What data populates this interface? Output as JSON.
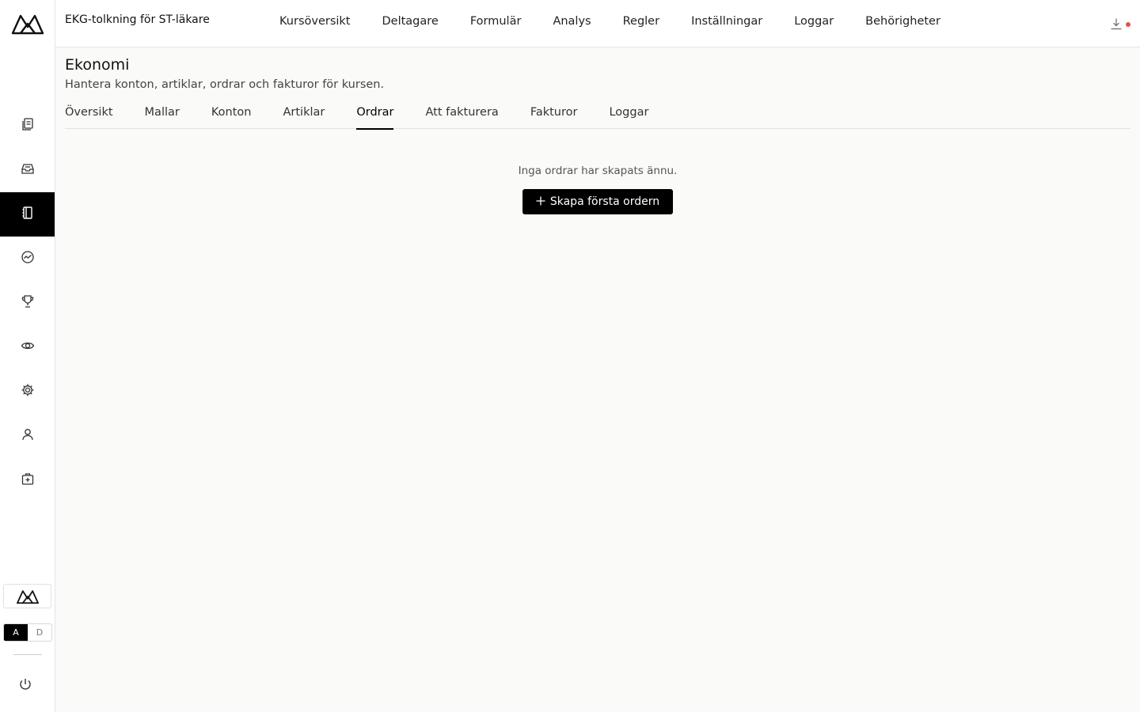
{
  "app": {
    "logo": "logo-icon"
  },
  "header": {
    "course_title": "EKG-tolkning för ST-läkare",
    "nav": [
      "Kursöversikt",
      "Deltagare",
      "Formulär",
      "Analys",
      "Regler",
      "Inställningar",
      "Loggar",
      "Behörigheter"
    ]
  },
  "sidebar": {
    "items": [
      {
        "icon": "documents-icon",
        "active": false
      },
      {
        "icon": "inbox-icon",
        "active": false
      },
      {
        "icon": "notebook-icon",
        "active": true
      },
      {
        "icon": "analytics-icon",
        "active": false
      },
      {
        "icon": "trophy-icon",
        "active": false
      },
      {
        "icon": "eye-icon",
        "active": false
      },
      {
        "icon": "gear-icon",
        "active": false
      },
      {
        "icon": "user-icon",
        "active": false
      },
      {
        "icon": "medical-kit-icon",
        "active": false
      }
    ],
    "toggle": {
      "a": "A",
      "d": "D",
      "selected": "A"
    }
  },
  "main": {
    "title": "Ekonomi",
    "subtitle": "Hantera konton, artiklar, ordrar och fakturor för kursen.",
    "tabs": [
      "Översikt",
      "Mallar",
      "Konton",
      "Artiklar",
      "Ordrar",
      "Att fakturera",
      "Fakturor",
      "Loggar"
    ],
    "active_tab": "Ordrar",
    "empty_message": "Inga ordrar har skapats ännu.",
    "create_button": "Skapa första ordern"
  },
  "colors": {
    "accent": "#000000",
    "notification": "#e0524b"
  }
}
